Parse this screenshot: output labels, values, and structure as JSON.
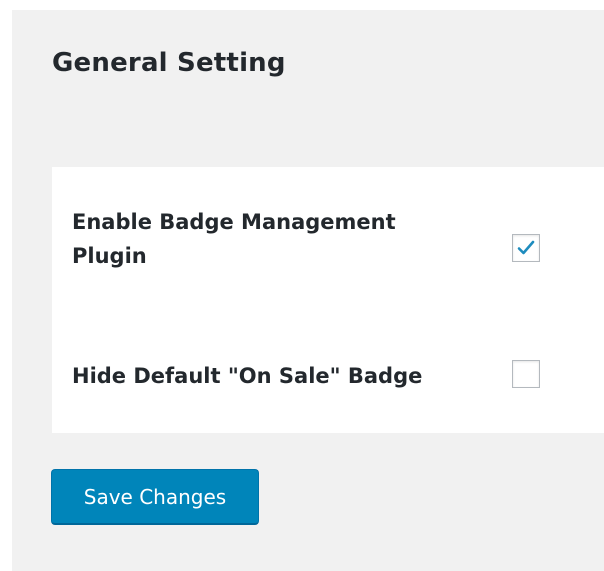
{
  "page": {
    "title": "General Setting"
  },
  "settings": [
    {
      "label": "Enable Badge Management Plugin",
      "checked": true
    },
    {
      "label": "Hide Default \"On Sale\" Badge",
      "checked": false
    }
  ],
  "actions": {
    "save_label": "Save Changes"
  },
  "colors": {
    "accent": "#0085ba",
    "checkmark": "#1e8cbe",
    "panel_bg": "#f1f1f1"
  },
  "icons": {
    "checkmark": "checkmark-icon"
  }
}
